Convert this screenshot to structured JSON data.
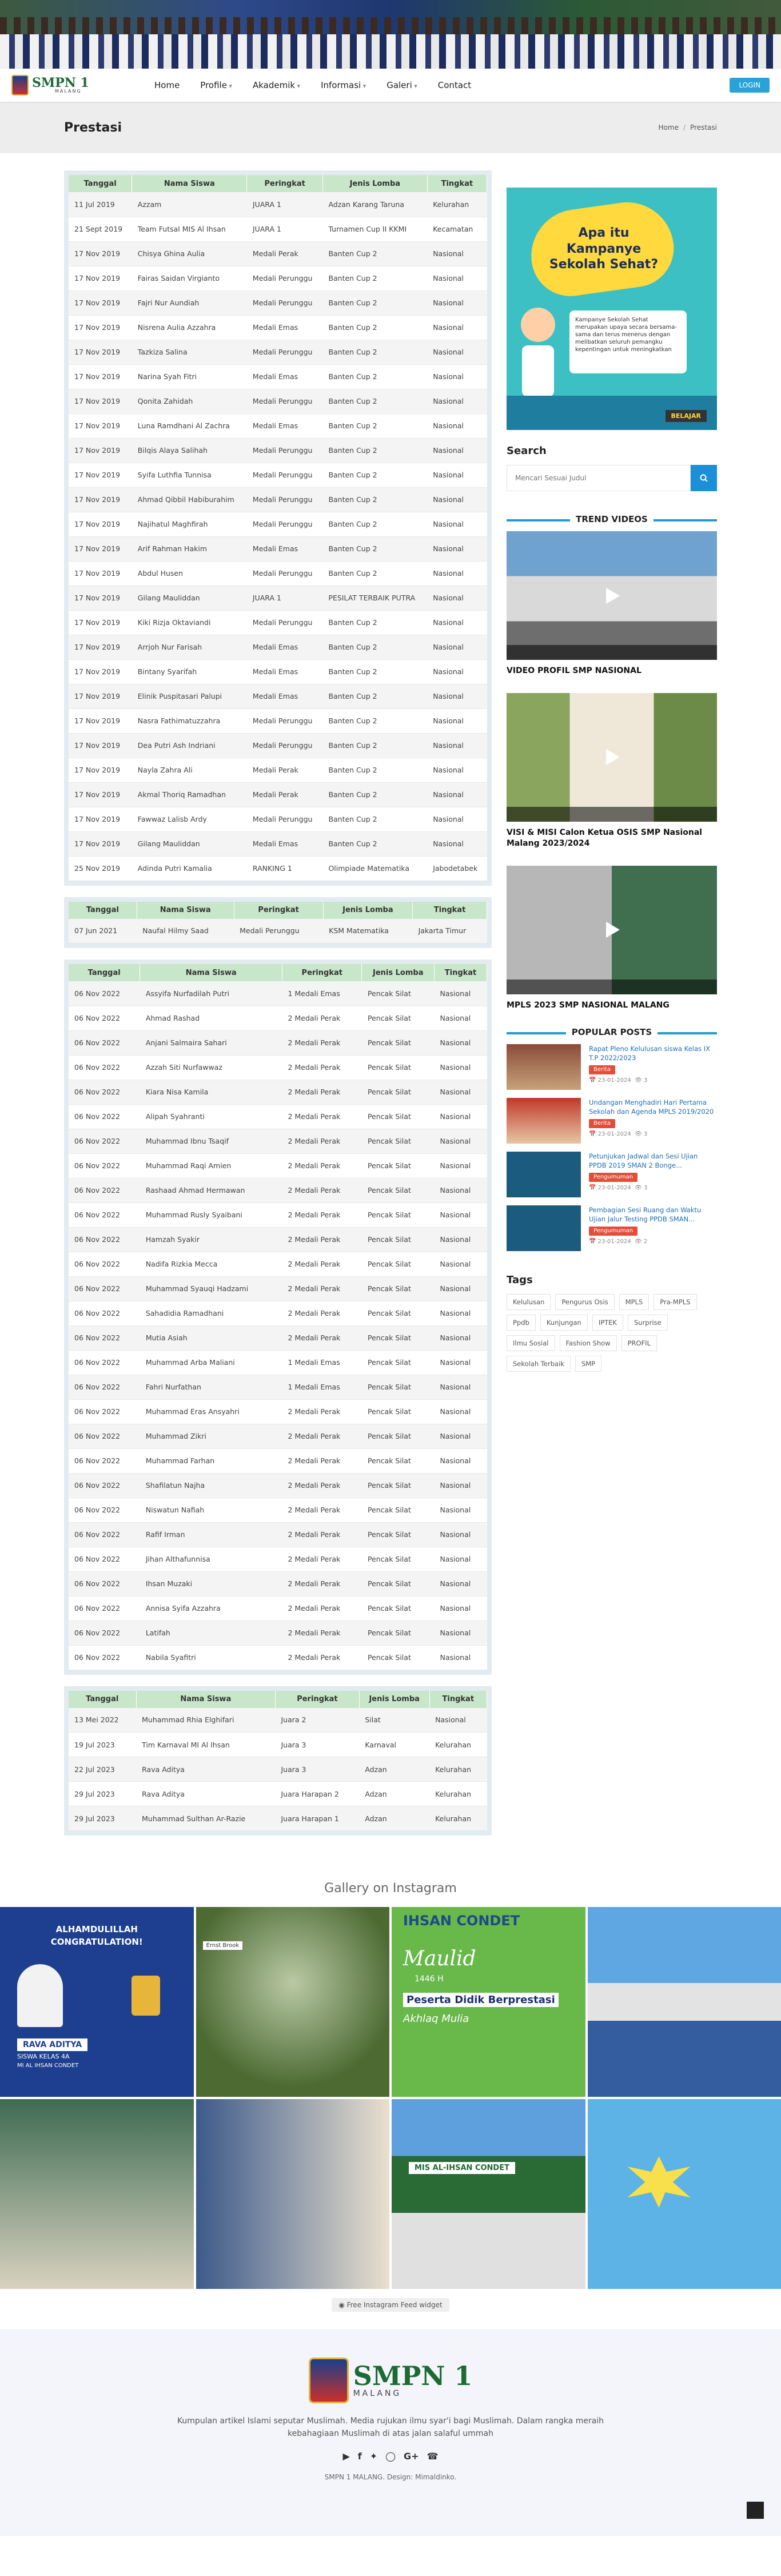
{
  "nav": {
    "logo_main": "SMPN 1",
    "logo_sub": "MALANG",
    "items": [
      "Home",
      "Profile",
      "Akademik",
      "Informasi",
      "Galeri",
      "Contact"
    ],
    "login": "LOGIN"
  },
  "titlebar": {
    "title": "Prestasi",
    "crumb_home": "Home",
    "crumb_current": "Prestasi"
  },
  "tables": [
    {
      "headers": [
        "Tanggal",
        "Nama Siswa",
        "Peringkat",
        "Jenis Lomba",
        "Tingkat"
      ],
      "rows": [
        [
          "11 Jul 2019",
          "Azzam",
          "JUARA 1",
          "Adzan Karang Taruna",
          "Kelurahan"
        ],
        [
          "21 Sept 2019",
          "Team Futsal MIS Al Ihsan",
          "JUARA 1",
          "Turnamen Cup II KKMI",
          "Kecamatan"
        ],
        [
          "17 Nov 2019",
          "Chisya Ghina Aulia",
          "Medali Perak",
          "Banten Cup 2",
          "Nasional"
        ],
        [
          "17 Nov 2019",
          "Fairas Saidan Virgianto",
          "Medali Perunggu",
          "Banten Cup 2",
          "Nasional"
        ],
        [
          "17 Nov 2019",
          "Fajri Nur Aundiah",
          "Medali Perunggu",
          "Banten Cup 2",
          "Nasional"
        ],
        [
          "17 Nov 2019",
          "Nisrena Aulia Azzahra",
          "Medali Emas",
          "Banten Cup 2",
          "Nasional"
        ],
        [
          "17 Nov 2019",
          "Tazkiza Salina",
          "Medali Perunggu",
          "Banten Cup 2",
          "Nasional"
        ],
        [
          "17 Nov 2019",
          "Narina Syah Fitri",
          "Medali Emas",
          "Banten Cup 2",
          "Nasional"
        ],
        [
          "17 Nov 2019",
          "Qonita Zahidah",
          "Medali Perunggu",
          "Banten Cup 2",
          "Nasional"
        ],
        [
          "17 Nov 2019",
          "Luna Ramdhani Al Zachra",
          "Medali Emas",
          "Banten Cup 2",
          "Nasional"
        ],
        [
          "17 Nov 2019",
          "Bilqis Alaya Salihah",
          "Medali Perunggu",
          "Banten Cup 2",
          "Nasional"
        ],
        [
          "17 Nov 2019",
          "Syifa Luthfia Tunnisa",
          "Medali Perunggu",
          "Banten Cup 2",
          "Nasional"
        ],
        [
          "17 Nov 2019",
          "Ahmad Qibbil Habiburahim",
          "Medali Perunggu",
          "Banten Cup 2",
          "Nasional"
        ],
        [
          "17 Nov 2019",
          "Najihatul Maghfirah",
          "Medali Perunggu",
          "Banten Cup 2",
          "Nasional"
        ],
        [
          "17 Nov 2019",
          "Arif Rahman Hakim",
          "Medali Emas",
          "Banten Cup 2",
          "Nasional"
        ],
        [
          "17 Nov 2019",
          "Abdul Husen",
          "Medali Perunggu",
          "Banten Cup 2",
          "Nasional"
        ],
        [
          "17 Nov 2019",
          "Gilang Mauliddan",
          "JUARA 1",
          "PESILAT TERBAIK PUTRA",
          "Nasional"
        ],
        [
          "17 Nov 2019",
          "Kiki Rizja Oktaviandi",
          "Medali Perunggu",
          "Banten Cup 2",
          "Nasional"
        ],
        [
          "17 Nov 2019",
          "Arrjoh Nur Farisah",
          "Medali Emas",
          "Banten Cup 2",
          "Nasional"
        ],
        [
          "17 Nov 2019",
          "Bintany Syarifah",
          "Medali Emas",
          "Banten Cup 2",
          "Nasional"
        ],
        [
          "17 Nov 2019",
          "Elinik Puspitasari Palupi",
          "Medali Emas",
          "Banten Cup 2",
          "Nasional"
        ],
        [
          "17 Nov 2019",
          "Nasra Fathimatuzzahra",
          "Medali Perunggu",
          "Banten Cup 2",
          "Nasional"
        ],
        [
          "17 Nov 2019",
          "Dea Putri Ash Indriani",
          "Medali Perunggu",
          "Banten Cup 2",
          "Nasional"
        ],
        [
          "17 Nov 2019",
          "Nayla Zahra Ali",
          "Medali Perak",
          "Banten Cup 2",
          "Nasional"
        ],
        [
          "17 Nov 2019",
          "Akmal Thoriq Ramadhan",
          "Medali Perak",
          "Banten Cup 2",
          "Nasional"
        ],
        [
          "17 Nov 2019",
          "Fawwaz Lalisb Ardy",
          "Medali Perunggu",
          "Banten Cup 2",
          "Nasional"
        ],
        [
          "17 Nov 2019",
          "Gilang Mauliddan",
          "Medali Emas",
          "Banten Cup 2",
          "Nasional"
        ],
        [
          "25 Nov 2019",
          "Adinda Putri Kamalia",
          "RANKING 1",
          "Olimpiade Matematika",
          "Jabodetabek"
        ]
      ]
    },
    {
      "headers": [
        "Tanggal",
        "Nama Siswa",
        "Peringkat",
        "Jenis Lomba",
        "Tingkat"
      ],
      "rows": [
        [
          "07 Jun 2021",
          "Naufal Hilmy Saad",
          "Medali Perunggu",
          "KSM Matematika",
          "Jakarta Timur"
        ]
      ]
    },
    {
      "headers": [
        "Tanggal",
        "Nama Siswa",
        "Peringkat",
        "Jenis Lomba",
        "Tingkat"
      ],
      "rows": [
        [
          "06 Nov 2022",
          "Assyifa Nurfadilah Putri",
          "1 Medali Emas",
          "Pencak Silat",
          "Nasional"
        ],
        [
          "06 Nov 2022",
          "Ahmad Rashad",
          "2 Medali Perak",
          "Pencak Silat",
          "Nasional"
        ],
        [
          "06 Nov 2022",
          "Anjani Salmaira Sahari",
          "2 Medali Perak",
          "Pencak Silat",
          "Nasional"
        ],
        [
          "06 Nov 2022",
          "Azzah Siti Nurfawwaz",
          "2 Medali Perak",
          "Pencak Silat",
          "Nasional"
        ],
        [
          "06 Nov 2022",
          "Kiara Nisa Kamila",
          "2 Medali Perak",
          "Pencak Silat",
          "Nasional"
        ],
        [
          "06 Nov 2022",
          "Alipah Syahranti",
          "2 Medali Perak",
          "Pencak Silat",
          "Nasional"
        ],
        [
          "06 Nov 2022",
          "Muhammad Ibnu Tsaqif",
          "2 Medali Perak",
          "Pencak Silat",
          "Nasional"
        ],
        [
          "06 Nov 2022",
          "Muhammad Raqi Amien",
          "2 Medali Perak",
          "Pencak Silat",
          "Nasional"
        ],
        [
          "06 Nov 2022",
          "Rashaad Ahmad Hermawan",
          "2 Medali Perak",
          "Pencak Silat",
          "Nasional"
        ],
        [
          "06 Nov 2022",
          "Muhammad Rusly Syaibani",
          "2 Medali Perak",
          "Pencak Silat",
          "Nasional"
        ],
        [
          "06 Nov 2022",
          "Hamzah Syakir",
          "2 Medali Perak",
          "Pencak Silat",
          "Nasional"
        ],
        [
          "06 Nov 2022",
          "Nadifa Rizkia Mecca",
          "2 Medali Perak",
          "Pencak Silat",
          "Nasional"
        ],
        [
          "06 Nov 2022",
          "Muhammad Syauqi Hadzami",
          "2 Medali Perak",
          "Pencak Silat",
          "Nasional"
        ],
        [
          "06 Nov 2022",
          "Sahadidia Ramadhani",
          "2 Medali Perak",
          "Pencak Silat",
          "Nasional"
        ],
        [
          "06 Nov 2022",
          "Mutia Asiah",
          "2 Medali Perak",
          "Pencak Silat",
          "Nasional"
        ],
        [
          "06 Nov 2022",
          "Muhammad Arba Maliani",
          "1 Medali Emas",
          "Pencak Silat",
          "Nasional"
        ],
        [
          "06 Nov 2022",
          "Fahri Nurfathan",
          "1 Medali Emas",
          "Pencak Silat",
          "Nasional"
        ],
        [
          "06 Nov 2022",
          "Muhammad Eras Ansyahri",
          "2 Medali Perak",
          "Pencak Silat",
          "Nasional"
        ],
        [
          "06 Nov 2022",
          "Muhammad Zikri",
          "2 Medali Perak",
          "Pencak Silat",
          "Nasional"
        ],
        [
          "06 Nov 2022",
          "Muhammad Farhan",
          "2 Medali Perak",
          "Pencak Silat",
          "Nasional"
        ],
        [
          "06 Nov 2022",
          "Shafilatun Najha",
          "2 Medali Perak",
          "Pencak Silat",
          "Nasional"
        ],
        [
          "06 Nov 2022",
          "Niswatun Nafiah",
          "2 Medali Perak",
          "Pencak Silat",
          "Nasional"
        ],
        [
          "06 Nov 2022",
          "Rafif Irman",
          "2 Medali Perak",
          "Pencak Silat",
          "Nasional"
        ],
        [
          "06 Nov 2022",
          "Jihan Althafunnisa",
          "2 Medali Perak",
          "Pencak Silat",
          "Nasional"
        ],
        [
          "06 Nov 2022",
          "Ihsan Muzaki",
          "2 Medali Perak",
          "Pencak Silat",
          "Nasional"
        ],
        [
          "06 Nov 2022",
          "Annisa Syifa Azzahra",
          "2 Medali Perak",
          "Pencak Silat",
          "Nasional"
        ],
        [
          "06 Nov 2022",
          "Latifah",
          "2 Medali Perak",
          "Pencak Silat",
          "Nasional"
        ],
        [
          "06 Nov 2022",
          "Nabila Syafitri",
          "2 Medali Perak",
          "Pencak Silat",
          "Nasional"
        ]
      ]
    },
    {
      "headers": [
        "Tanggal",
        "Nama Siswa",
        "Peringkat",
        "Jenis Lomba",
        "Tingkat"
      ],
      "rows": [
        [
          "13 Mei 2022",
          "Muhammad Rhia Elghifari",
          "Juara 2",
          "Silat",
          "Nasional"
        ],
        [
          "19 Jul 2023",
          "Tim Karnaval MI Al Ihsan",
          "Juara 3",
          "Karnaval",
          "Kelurahan"
        ],
        [
          "22 Jul 2023",
          "Rava Aditya",
          "Juara 3",
          "Adzan",
          "Kelurahan"
        ],
        [
          "29 Jul 2023",
          "Rava Aditya",
          "Juara Harapan 2",
          "Adzan",
          "Kelurahan"
        ],
        [
          "29 Jul 2023",
          "Muhammad Sulthan Ar-Razie",
          "Juara Harapan 1",
          "Adzan",
          "Kelurahan"
        ]
      ]
    }
  ],
  "ad": {
    "title": "Apa itu Kampanye Sekolah Sehat?",
    "body": "Kampanye Sekolah Sehat merupakan upaya secara bersama-sama dan terus menerus dengan melibatkan seluruh pemangku kepentingan untuk meningkatkan",
    "tag": "BELAJAR"
  },
  "search": {
    "title": "Search",
    "placeholder": "Mencari Sesuai Judul"
  },
  "videos": {
    "title": "TREND VIDEOS",
    "items": [
      "VIDEO PROFIL SMP NASIONAL",
      "VISI & MISI Calon Ketua OSIS SMP Nasional Malang 2023/2024",
      "MPLS 2023 SMP NASIONAL MALANG"
    ]
  },
  "popular": {
    "title": "POPULAR POSTS",
    "items": [
      {
        "title": "Rapat Pleno Kelulusan siswa Kelas IX T.P 2022/2023",
        "badge": "Berita",
        "date": "23-01-2024",
        "count": "3"
      },
      {
        "title": "Undangan Menghadiri Hari Pertama Sekolah dan Agenda MPLS 2019/2020",
        "badge": "Berita",
        "date": "23-01-2024",
        "count": "3"
      },
      {
        "title": "Petunjukan Jadwal dan Sesi Ujian PPDB 2019 SMAN 2 Bonge...",
        "badge": "Pengumuman",
        "date": "23-01-2024",
        "count": "3"
      },
      {
        "title": "Pembagian Sesi Ruang dan Waktu Ujian Jalur Testing PPDB SMAN...",
        "badge": "Pengumuman",
        "date": "23-01-2024",
        "count": "2"
      }
    ]
  },
  "tags": {
    "title": "Tags",
    "items": [
      "Kelulusan",
      "Pengurus Osis",
      "MPLS",
      "Pra-MPLS",
      "Ppdb",
      "Kunjungan",
      "IPTEK",
      "Surprise",
      "Ilmu Sosial",
      "Fashion Show",
      "PROFIL",
      "Sekolah Terbaik",
      "SMP"
    ]
  },
  "gallery": {
    "title": "Gallery on Instagram",
    "g1_line1": "ALHAMDULILLAH",
    "g1_line2": "CONGRATULATION!",
    "g1_name": "RAVA ADITYA",
    "g1_sub": "SISWA KELAS 4A",
    "g1_medal": "MI AL IHSAN CONDET",
    "g2_text": "Ernst Brook",
    "g3_top": "IHSAN CONDET",
    "g3_mid": "Maulid",
    "g3_sub": "1446 H",
    "g3_line": "Peserta Didik Berprestasi",
    "g3_line2": "Akhlaq Mulia",
    "g7_text": "MIS AL-IHSAN CONDET",
    "feed_link": "Free Instagram Feed widget"
  },
  "footer": {
    "logo_main": "SMPN 1",
    "logo_sub": "MALANG",
    "desc": "Kumpulan artikel Islami seputar Muslimah. Media rujukan ilmu syar'i bagi Muslimah. Dalam rangka meraih kebahagiaan Muslimah di atas jalan salaful ummah",
    "copy": "SMPN 1 MALANG. Design: Mimaldinko."
  },
  "colors": {
    "accent": "#1f9bd2",
    "header_green": "#c8e6c9",
    "brand_green": "#1d6a34"
  }
}
